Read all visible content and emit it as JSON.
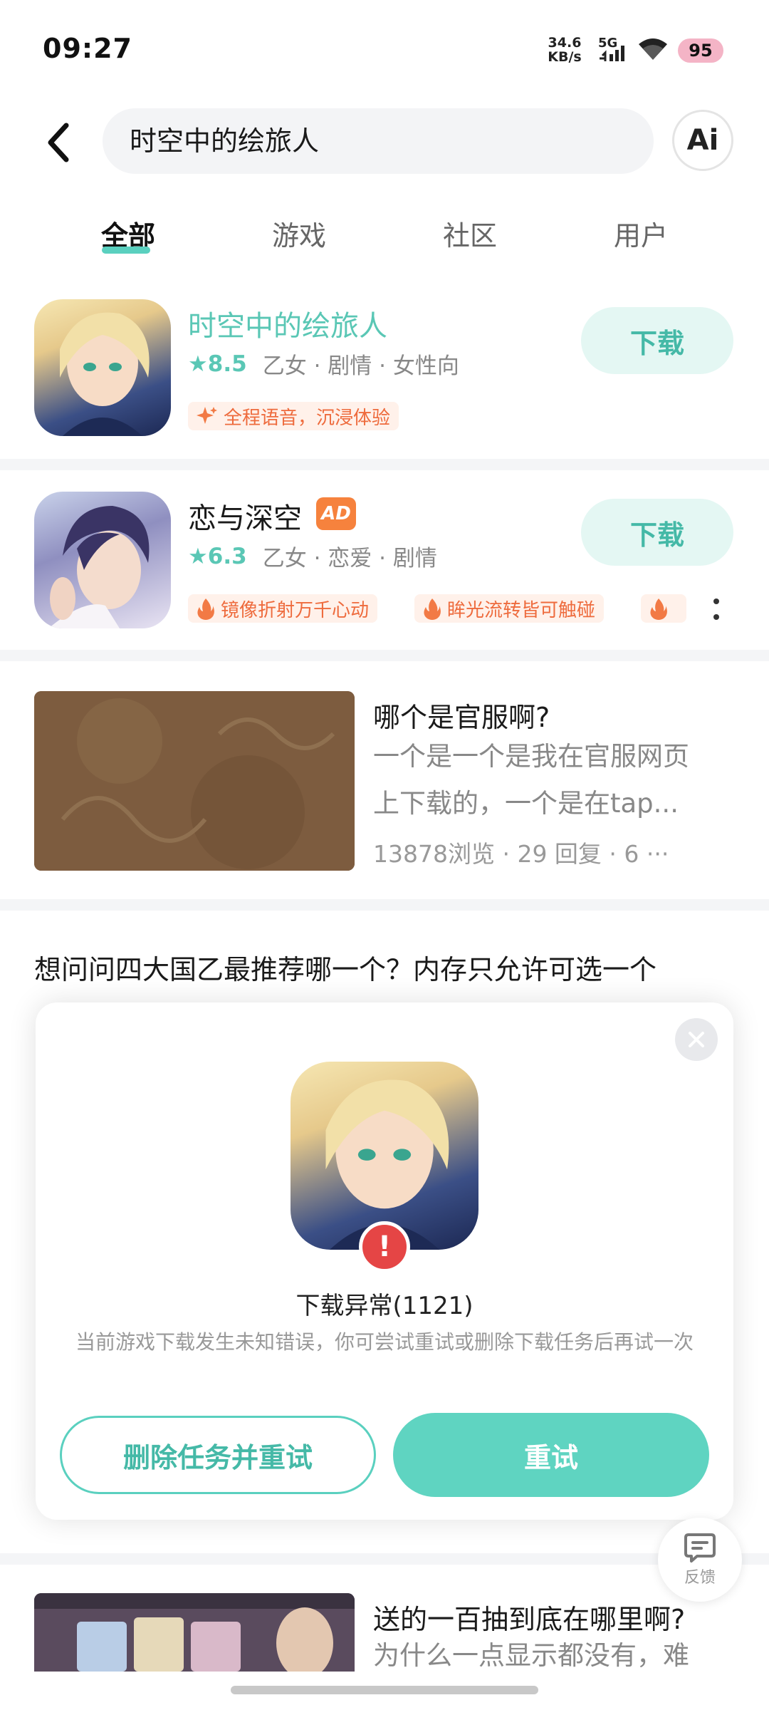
{
  "status_bar": {
    "time": "09:27",
    "net_speed_value": "34.6",
    "net_speed_unit": "KB/s",
    "network": "5G",
    "battery": "95"
  },
  "header": {
    "search_query": "时空中的绘旅人",
    "ai_label": "Ai"
  },
  "tabs": [
    {
      "label": "全部",
      "active": true
    },
    {
      "label": "游戏",
      "active": false
    },
    {
      "label": "社区",
      "active": false
    },
    {
      "label": "用户",
      "active": false
    }
  ],
  "games": [
    {
      "title": "时空中的绘旅人",
      "rating": "8.5",
      "genres": "乙女 · 剧情 · 女性向",
      "button": "下载",
      "tags": [
        "全程语音，沉浸体验"
      ]
    },
    {
      "title": "恋与深空",
      "ad_badge": "AD",
      "rating": "6.3",
      "genres": "乙女 · 恋爱 · 剧情",
      "button": "下载",
      "tags": [
        "镜像折射万千心动",
        "眸光流转皆可触碰"
      ]
    }
  ],
  "posts": [
    {
      "title": "哪个是官服啊?",
      "excerpt_line1": "一个是一个是我在官服网页",
      "excerpt_line2": "上下载的，一个是在tap...",
      "meta": "13878浏览 · 29 回复 · 6 ···"
    },
    {
      "title": "想问问四大国乙最推荐哪一个？内存只允许可选一个"
    },
    {
      "title": "送的一百抽到底在哪里啊?",
      "excerpt_line1": "为什么一点显示都没有，难"
    }
  ],
  "dialog": {
    "title": "下载异常(1121)",
    "description": "当前游戏下载发生未知错误，你可尝试重试或删除下载任务后再试一次",
    "secondary_button": "删除任务并重试",
    "primary_button": "重试"
  },
  "feedback": {
    "label": "反馈"
  },
  "colors": {
    "accent": "#5fd4c1",
    "accent_text": "#45b9a7",
    "tag_text": "#ee6b3d",
    "error": "#e54545"
  }
}
